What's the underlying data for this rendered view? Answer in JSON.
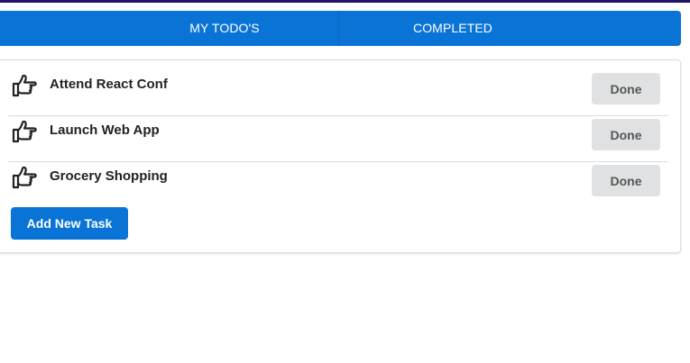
{
  "colors": {
    "primary": "#0a74d6",
    "topline": "#221366",
    "done_button_bg": "#e0e1e2"
  },
  "tabs": [
    {
      "label": "MY TODO'S"
    },
    {
      "label": "COMPLETED"
    }
  ],
  "tasks": [
    {
      "icon": "hand-point-right-icon",
      "label": "Attend React Conf",
      "action": "Done"
    },
    {
      "icon": "hand-point-right-icon",
      "label": "Launch Web App",
      "action": "Done"
    },
    {
      "icon": "hand-point-right-icon",
      "label": "Grocery Shopping",
      "action": "Done"
    }
  ],
  "add_task_label": "Add New Task"
}
